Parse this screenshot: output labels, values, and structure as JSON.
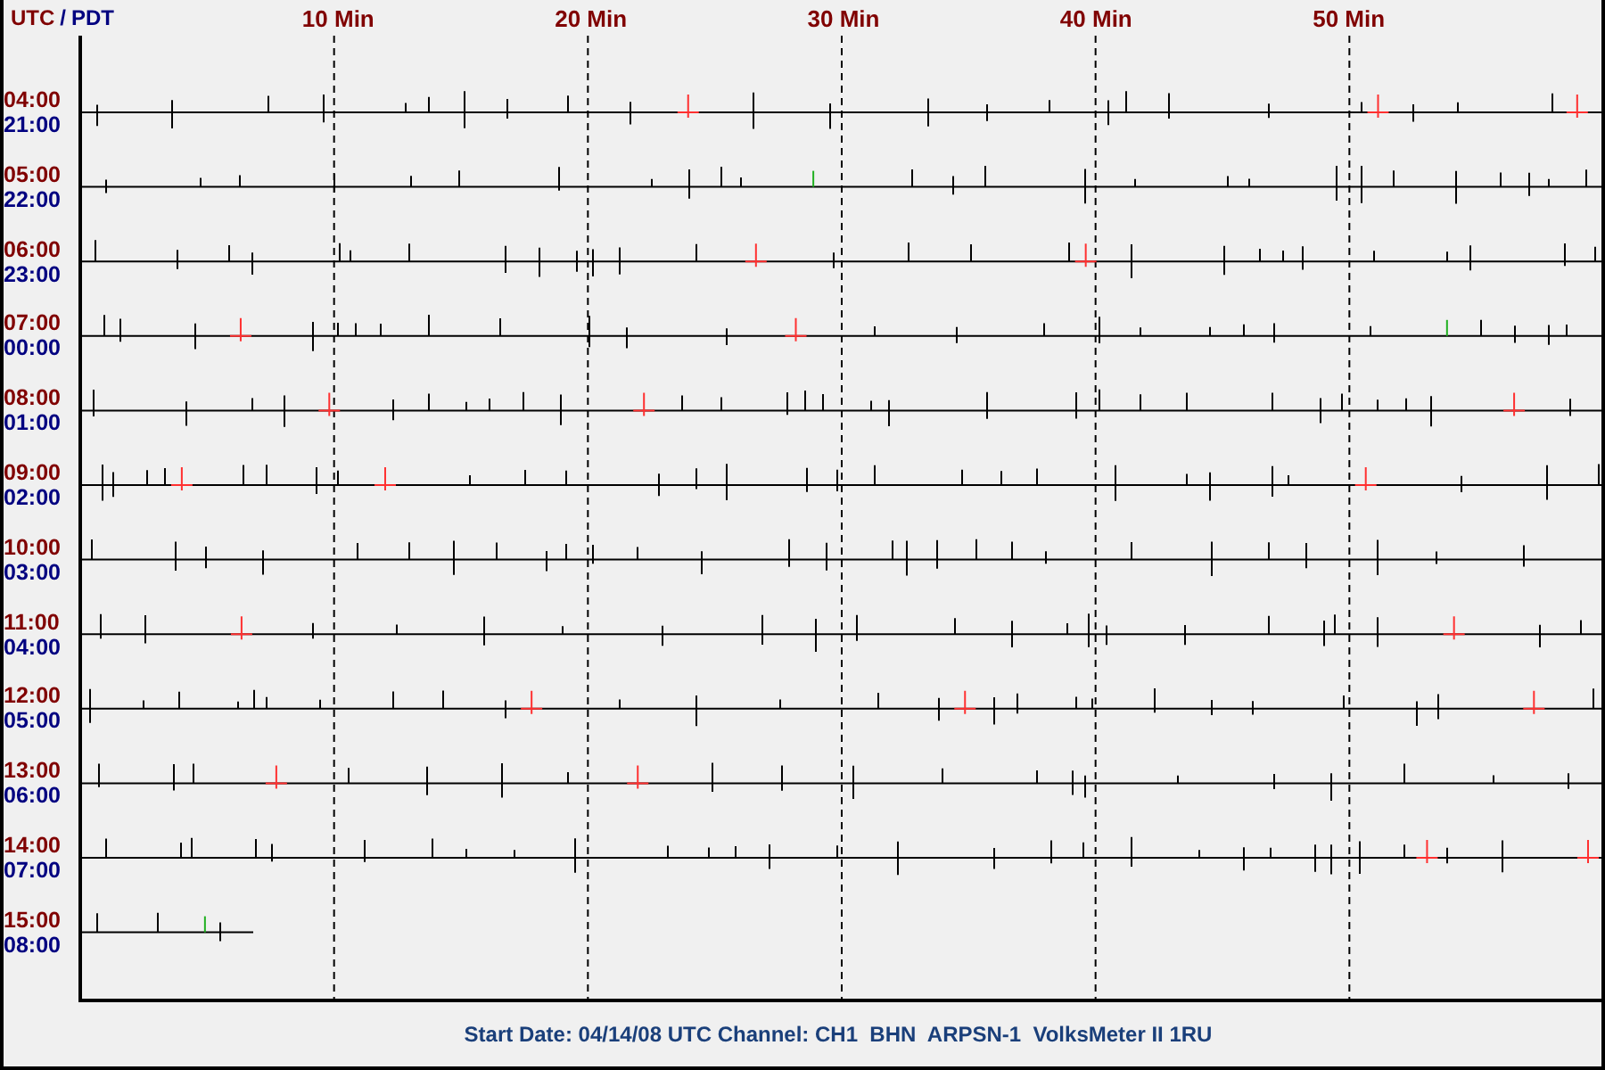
{
  "header": {
    "utc_label": "UTC",
    "separator": "/",
    "local_label": "PDT"
  },
  "minute_labels": [
    "10 Min",
    "20 Min",
    "30 Min",
    "40 Min",
    "50 Min"
  ],
  "rows": [
    {
      "utc": "04:00",
      "local": "21:00",
      "complete": true
    },
    {
      "utc": "05:00",
      "local": "22:00",
      "complete": true
    },
    {
      "utc": "06:00",
      "local": "23:00",
      "complete": true
    },
    {
      "utc": "07:00",
      "local": "00:00",
      "complete": true
    },
    {
      "utc": "08:00",
      "local": "01:00",
      "complete": true
    },
    {
      "utc": "09:00",
      "local": "02:00",
      "complete": true
    },
    {
      "utc": "10:00",
      "local": "03:00",
      "complete": true
    },
    {
      "utc": "11:00",
      "local": "04:00",
      "complete": true
    },
    {
      "utc": "12:00",
      "local": "05:00",
      "complete": true
    },
    {
      "utc": "13:00",
      "local": "06:00",
      "complete": true
    },
    {
      "utc": "14:00",
      "local": "07:00",
      "complete": true
    },
    {
      "utc": "15:00",
      "local": "08:00",
      "complete": false
    }
  ],
  "footer": "Start Date: 04/14/08 UTC Channel: CH1  BHN  ARPSN-1  VolksMeter II 1RU"
}
